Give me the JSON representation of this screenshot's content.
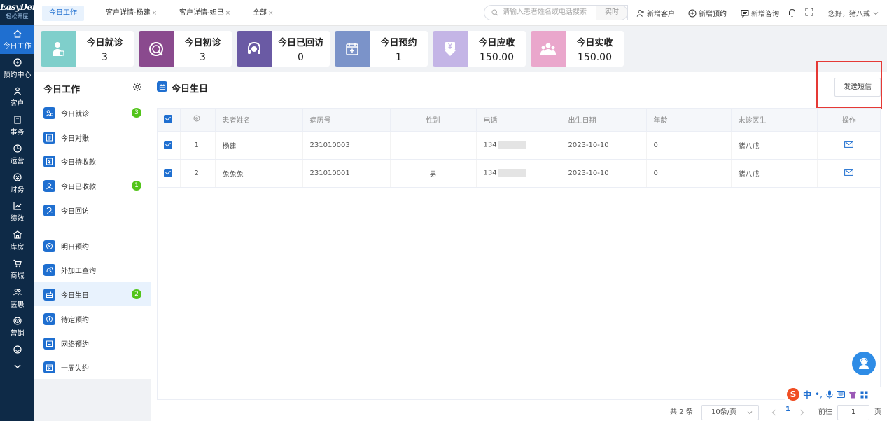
{
  "brand": {
    "name": "EasyDent",
    "sub": "轻松开医"
  },
  "nav": [
    {
      "label": "今日工作",
      "icon": "home-icon",
      "active": true
    },
    {
      "label": "预约中心",
      "icon": "calendar-circle-icon"
    },
    {
      "label": "客户",
      "icon": "user-icon"
    },
    {
      "label": "事务",
      "icon": "document-icon"
    },
    {
      "label": "运营",
      "icon": "clock-icon"
    },
    {
      "label": "财务",
      "icon": "finance-icon"
    },
    {
      "label": "绩效",
      "icon": "chart-icon"
    },
    {
      "label": "库房",
      "icon": "warehouse-icon"
    },
    {
      "label": "商城",
      "icon": "cart-icon"
    },
    {
      "label": "医患",
      "icon": "people-icon"
    },
    {
      "label": "营销",
      "icon": "target-icon"
    },
    {
      "label": "",
      "icon": "settings-icon"
    },
    {
      "label": "",
      "icon": "chevron-down-icon"
    }
  ],
  "tabs": [
    {
      "label": "今日工作",
      "active": true,
      "closable": false
    },
    {
      "label": "客户详情-杨建",
      "closable": true
    },
    {
      "label": "客户详情-妲己",
      "closable": true
    },
    {
      "label": "全部",
      "closable": true
    }
  ],
  "search": {
    "placeholder": "请输入患者姓名或电话搜索",
    "button": "实时"
  },
  "top_actions": {
    "new_customer": "新增客户",
    "new_appointment": "新增预约",
    "new_consult": "新增咨询",
    "greeting": "您好，猪八戒"
  },
  "stats": [
    {
      "title": "今日就诊",
      "value": "3",
      "color": "#7fcfcb",
      "icon": "visit-icon"
    },
    {
      "title": "今日初诊",
      "value": "3",
      "color": "#8a4a8e",
      "icon": "first-visit-icon"
    },
    {
      "title": "今日已回访",
      "value": "0",
      "color": "#6a5aa4",
      "icon": "headset-icon"
    },
    {
      "title": "今日预约",
      "value": "1",
      "color": "#7b93c9",
      "icon": "calendar-plus-icon"
    },
    {
      "title": "今日应收",
      "value": "150.00",
      "color": "#c4b5e6",
      "icon": "money-icon"
    },
    {
      "title": "今日实收",
      "value": "150.00",
      "color": "#eaa7cc",
      "icon": "group-icon"
    }
  ],
  "sidepanel": {
    "title": "今日工作",
    "items": [
      {
        "label": "今日就诊",
        "badge": "3"
      },
      {
        "label": "今日对账"
      },
      {
        "label": "今日待收款"
      },
      {
        "label": "今日已收款",
        "badge": "1"
      },
      {
        "label": "今日回访"
      },
      {
        "label": "明日预约"
      },
      {
        "label": "外加工查询"
      },
      {
        "label": "今日生日",
        "badge": "2",
        "active": true
      },
      {
        "label": "待定预约"
      },
      {
        "label": "网络预约"
      },
      {
        "label": "一周失约"
      }
    ]
  },
  "main": {
    "title": "今日生日",
    "send_sms": "发送短信",
    "columns": [
      "患者姓名",
      "病历号",
      "性别",
      "电话",
      "出生日期",
      "年龄",
      "未诊医生",
      "操作"
    ],
    "rows": [
      {
        "index": "1",
        "name": "杨建",
        "record": "231010003",
        "gender": "",
        "phone": "134",
        "birth": "2023-10-10",
        "age": "0",
        "doctor": "猪八戒"
      },
      {
        "index": "2",
        "name": "兔兔兔",
        "record": "231010001",
        "gender": "男",
        "phone": "134",
        "birth": "2023-10-10",
        "age": "0",
        "doctor": "猪八戒"
      }
    ]
  },
  "pagination": {
    "total": "共 2 条",
    "page_size": "10条/页",
    "current_page": "1",
    "goto_label": "前往",
    "goto_value": "1",
    "page_unit": "页"
  },
  "colors": {
    "primary": "#1f6fd0",
    "nav_bg": "#0e2a47",
    "badge": "#52c41a",
    "highlight_box": "#e53935"
  }
}
